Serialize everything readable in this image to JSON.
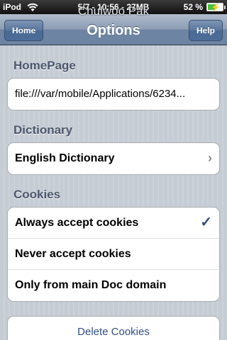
{
  "status_bar": {
    "carrier": "iPod",
    "time": "5/7 - 10:56 - 27MB",
    "battery": "52 %"
  },
  "overlay_name": "Chulwoo Pak",
  "nav": {
    "title": "Options",
    "left_button": "Home",
    "right_button": "Help"
  },
  "homepage": {
    "header": "HomePage",
    "value": "file:///var/mobile/Applications/6234..."
  },
  "dictionary": {
    "header": "Dictionary",
    "selected": "English Dictionary"
  },
  "cookies": {
    "header": "Cookies",
    "options": [
      "Always accept cookies",
      "Never accept cookies",
      "Only from main Doc domain"
    ],
    "selected_index": 0
  },
  "delete_cookies": "Delete Cookies",
  "colors": {
    "nav": "#6d84a2",
    "link": "#324f85",
    "check": "#344f7e"
  }
}
